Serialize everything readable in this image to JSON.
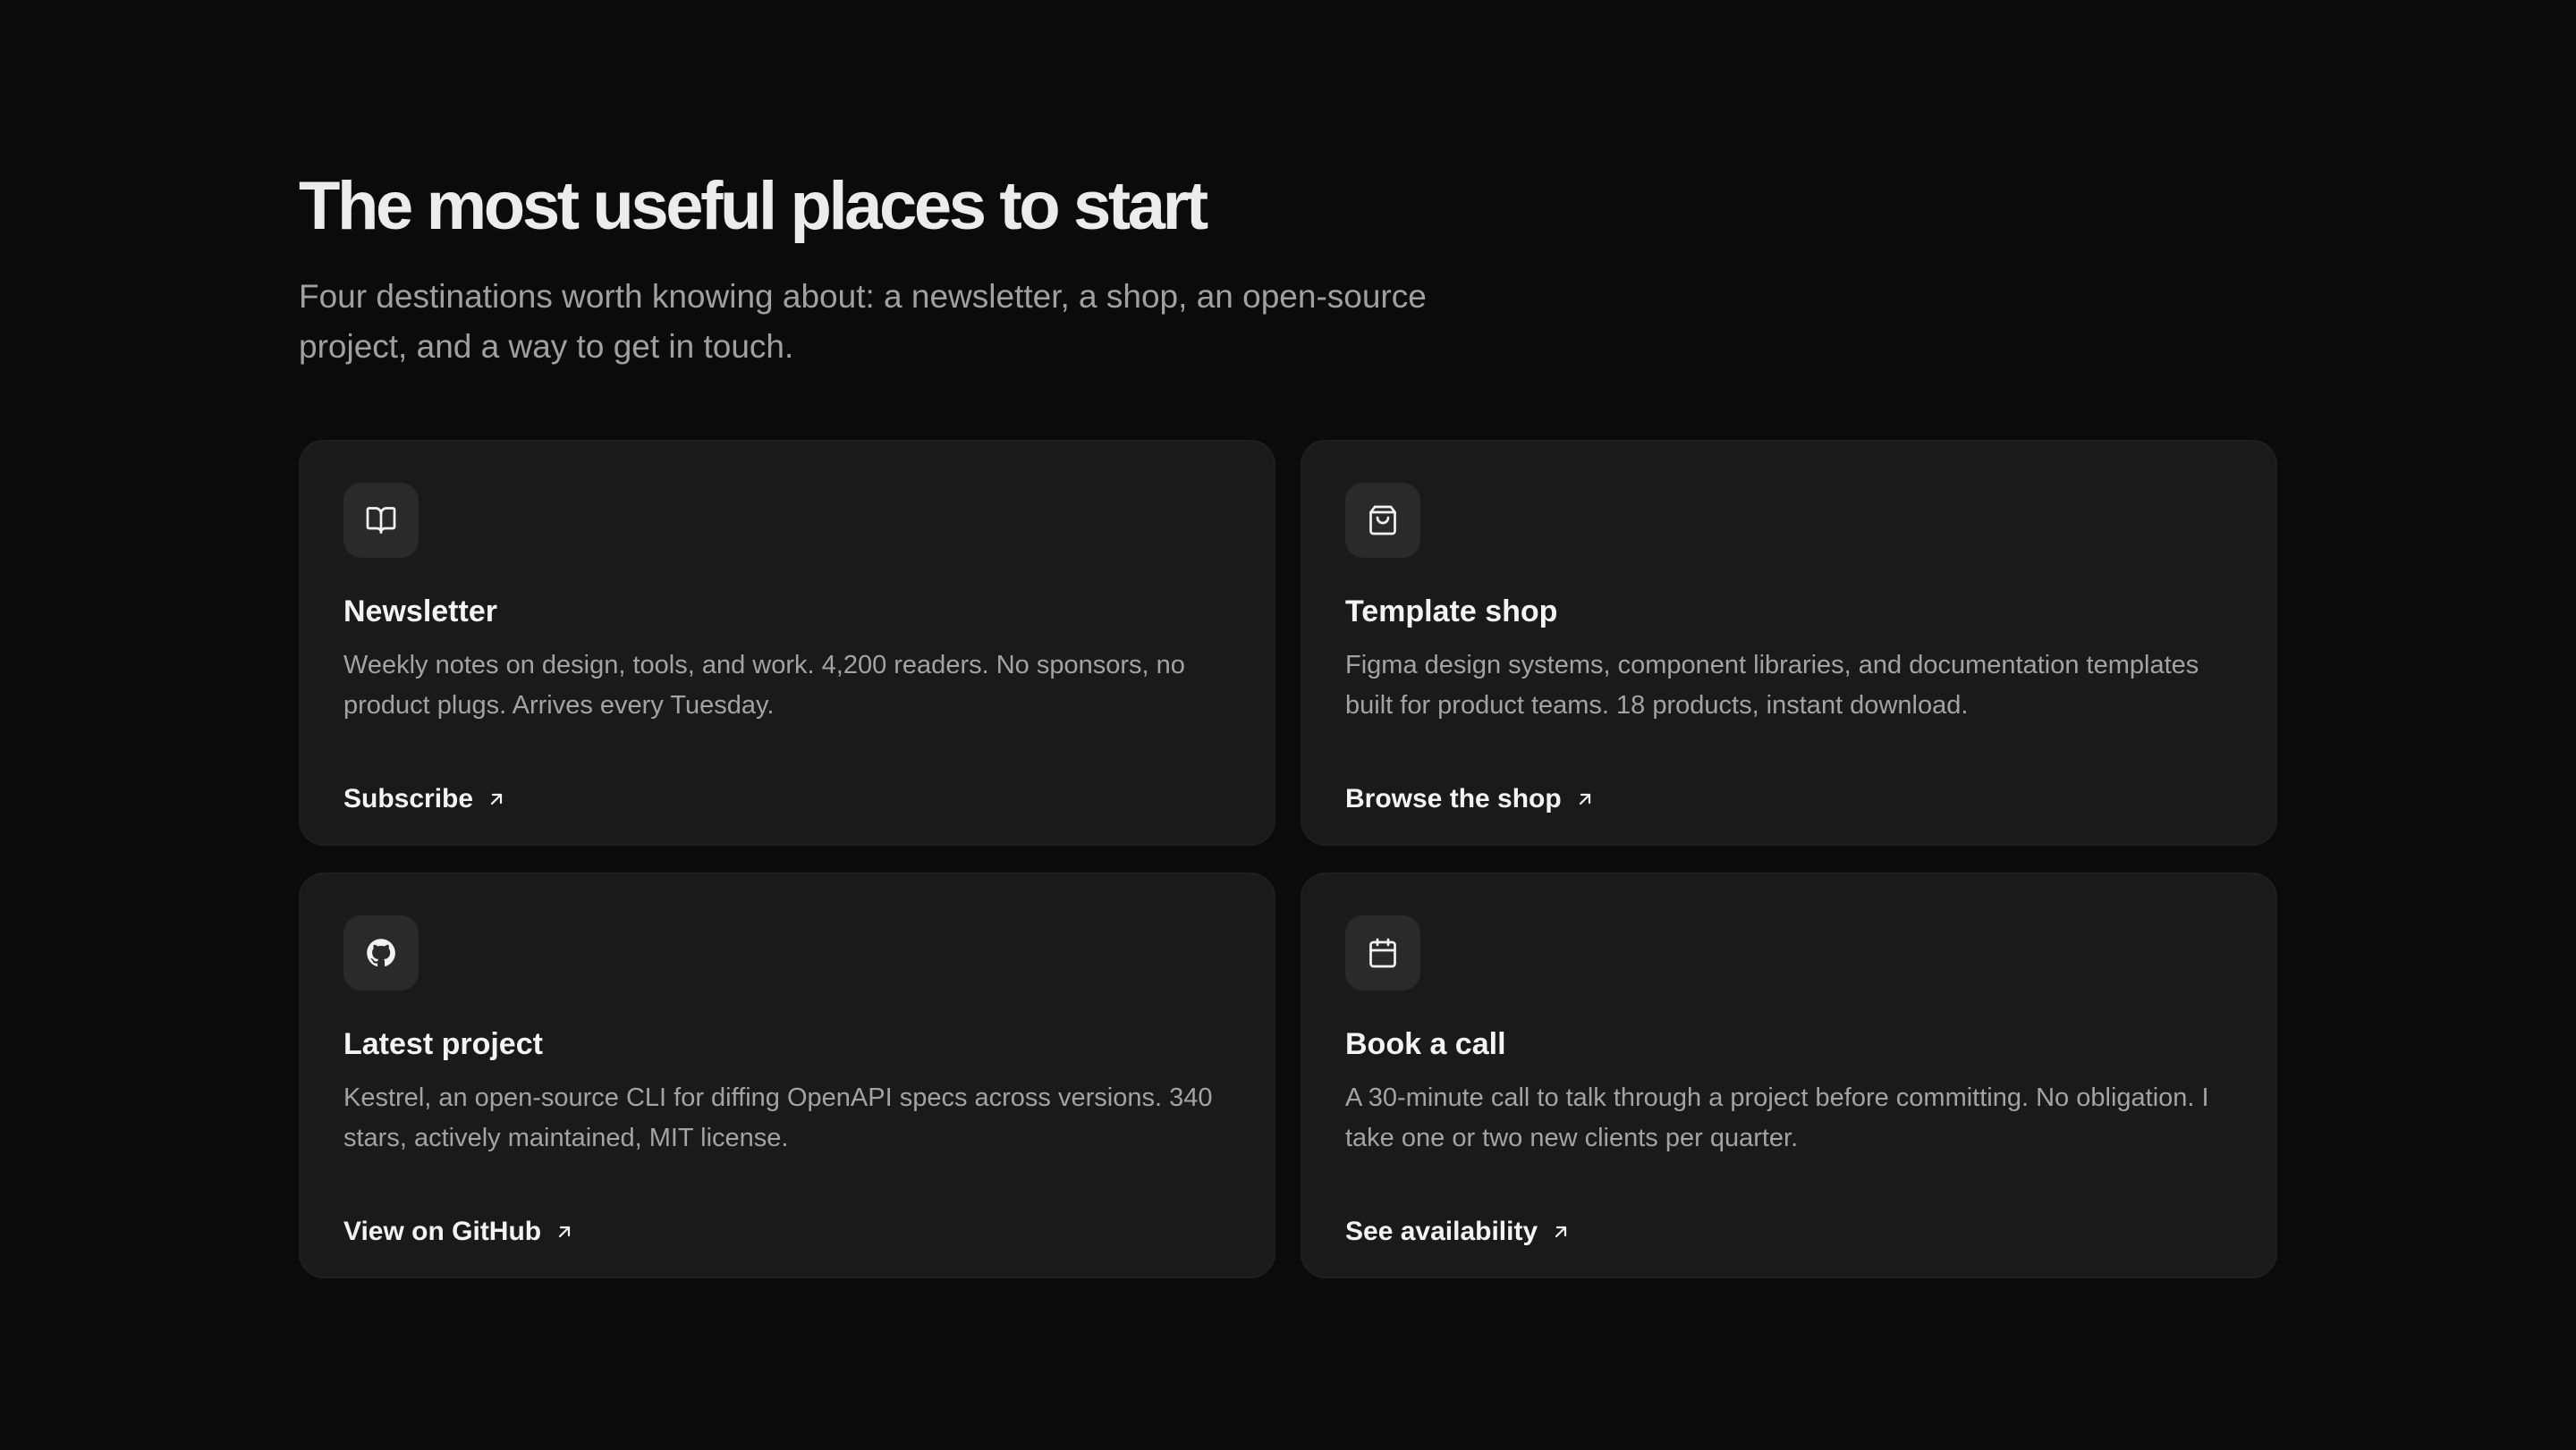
{
  "section": {
    "heading": "The most useful places to start",
    "subheading": "Four destinations worth knowing about: a newsletter, a shop, an open-source project, and a way to get in touch."
  },
  "cards": [
    {
      "icon": "book-open-icon",
      "title": "Newsletter",
      "description": "Weekly notes on design, tools, and work. 4,200 readers. No sponsors, no product plugs. Arrives every Tuesday.",
      "link_label": "Subscribe",
      "link_icon": "arrow-up-right-icon"
    },
    {
      "icon": "shopping-bag-icon",
      "title": "Template shop",
      "description": "Figma design systems, component libraries, and documentation templates built for product teams. 18 products, instant download.",
      "link_label": "Browse the shop",
      "link_icon": "arrow-up-right-icon"
    },
    {
      "icon": "github-icon",
      "title": "Latest project",
      "description": "Kestrel, an open-source CLI for diffing OpenAPI specs across versions. 340 stars, actively maintained, MIT license.",
      "link_label": "View on GitHub",
      "link_icon": "arrow-up-right-icon"
    },
    {
      "icon": "calendar-icon",
      "title": "Book a call",
      "description": "A 30-minute call to talk through a project before committing. No obligation. I take one or two new clients per quarter.",
      "link_label": "See availability",
      "link_icon": "arrow-up-right-icon"
    }
  ],
  "colors": {
    "background": "#0b0b0b",
    "card": "#1a1a1a",
    "icon_box": "#2a2a2a",
    "heading": "#ececec",
    "muted_text": "#a3a3a3"
  }
}
